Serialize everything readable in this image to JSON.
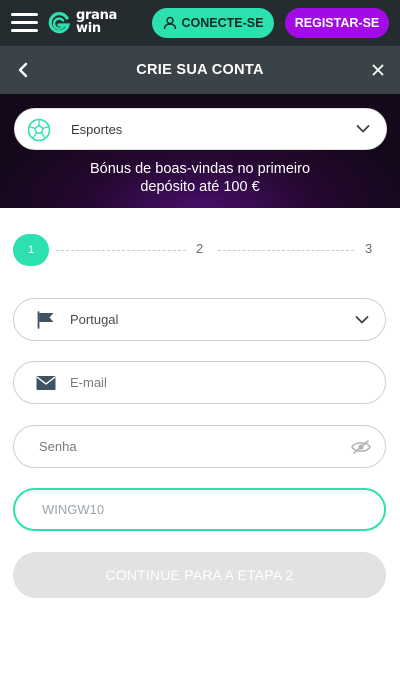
{
  "header": {
    "logo_line1": "grana",
    "logo_line2": "win",
    "login_label": "CONECTE-SE",
    "register_label": "REGISTAR-SE"
  },
  "titlebar": {
    "title": "CRIE SUA CONTA"
  },
  "promo": {
    "selected_sport": "Esportes",
    "bonus_line1": "Bónus de boas-vindas no primeiro",
    "bonus_line2": "depósito até 100 €"
  },
  "stepper": {
    "steps": [
      "1",
      "2",
      "3"
    ],
    "current_step": 1
  },
  "form": {
    "country": "Portugal",
    "email_placeholder": "E-mail",
    "password_placeholder": "Senha",
    "promo_code": "WINGW10",
    "continue_label": "CONTINUE PARA A ETAPA 2"
  },
  "colors": {
    "accent_green": "#2de0b0",
    "accent_purple": "#a20be8",
    "header_bg": "#252c30",
    "titlebar_bg": "#3a4347",
    "disabled_button": "#e2e2e2"
  },
  "icons": [
    "menu-icon",
    "granawin-logo-icon",
    "user-icon",
    "back-arrow-icon",
    "close-icon",
    "soccer-ball-icon",
    "chevron-down-icon",
    "flag-icon",
    "envelope-icon",
    "eye-hidden-icon"
  ]
}
